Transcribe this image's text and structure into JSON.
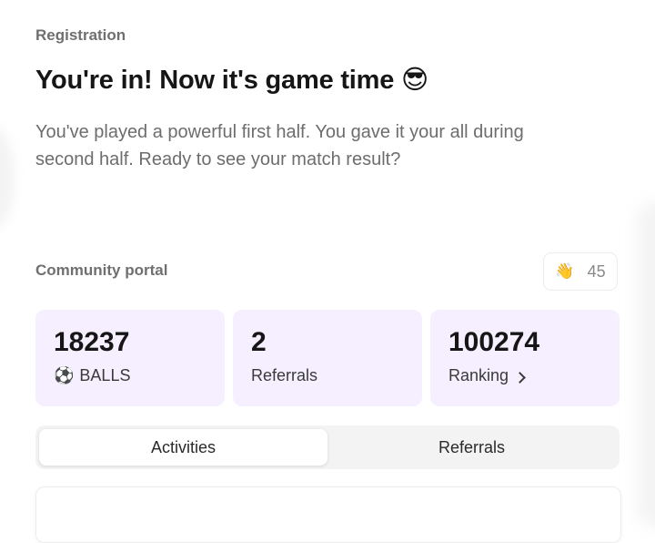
{
  "header": {
    "eyebrow": "Registration",
    "headline": "You're in! Now it's game time 😎",
    "body": "You've played a powerful first half. You gave it your all during second half. Ready to see your match result?"
  },
  "portal": {
    "label": "Community portal",
    "wave_emoji": "👋",
    "wave_count": "45"
  },
  "stats": [
    {
      "value": "18237",
      "icon": "⚽",
      "label": "BALLS"
    },
    {
      "value": "2",
      "label": "Referrals"
    },
    {
      "value": "100274",
      "label": "Ranking"
    }
  ],
  "tabs": [
    {
      "label": "Activities",
      "active": true
    },
    {
      "label": "Referrals",
      "active": false
    }
  ],
  "colors": {
    "card_bg": "#f6efff",
    "muted_text": "#6d6d6d",
    "tab_bg": "#f3f3f3"
  }
}
